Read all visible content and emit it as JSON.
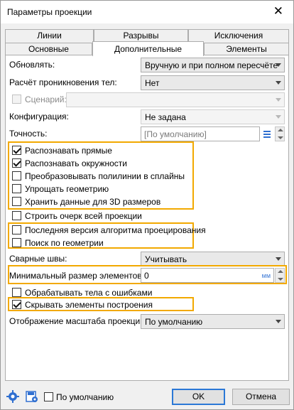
{
  "window": {
    "title": "Параметры проекции",
    "close_glyph": "✕"
  },
  "tabs_back": [
    {
      "label": "Линии"
    },
    {
      "label": "Разрывы"
    },
    {
      "label": "Исключения"
    }
  ],
  "tabs_front": [
    {
      "label": "Основные"
    },
    {
      "label": "Дополнительные",
      "active": true
    },
    {
      "label": "Элементы"
    }
  ],
  "fields": {
    "update": {
      "label": "Обновлять:",
      "value": "Вручную и при полном пересчёте"
    },
    "penetration": {
      "label": "Расчёт проникновения тел:",
      "value": "Нет"
    },
    "scenario": {
      "label": "Сценарий:",
      "value": "",
      "checked": false,
      "disabled": true
    },
    "configuration": {
      "label": "Конфигурация:",
      "value": "Не задана"
    },
    "accuracy": {
      "label": "Точность:",
      "placeholder": "[По умолчанию]"
    }
  },
  "checkboxes_group1": [
    {
      "label": "Распознавать прямые",
      "checked": true
    },
    {
      "label": "Распознавать окружности",
      "checked": true
    },
    {
      "label": "Преобразовывать полилинии в сплайны",
      "checked": false
    },
    {
      "label": "Упрощать геометрию",
      "checked": false
    },
    {
      "label": "Хранить данные для 3D размеров",
      "checked": false
    }
  ],
  "checkbox_sketch": {
    "label": "Строить очерк всей проекции",
    "checked": false
  },
  "checkboxes_group2": [
    {
      "label": "Последняя версия алгоритма проецирования",
      "checked": false
    },
    {
      "label": "Поиск по геометрии",
      "checked": false
    }
  ],
  "welds": {
    "label": "Сварные швы:",
    "value": "Учитывать"
  },
  "min_size": {
    "label": "Минимальный размер элементов:",
    "value": "0",
    "unit": "мм"
  },
  "checkbox_errors": {
    "label": "Обрабатывать тела с ошибками",
    "checked": false
  },
  "checkbox_hide": {
    "label": "Скрывать элементы построения",
    "checked": true
  },
  "scale_display": {
    "label": "Отображение масштаба проекции:",
    "value": "По умолчанию"
  },
  "footer": {
    "default_label": "По умолчанию",
    "default_checked": false,
    "ok_label": "OK",
    "cancel_label": "Отмена"
  },
  "colors": {
    "highlight": "#f2a900",
    "accent": "#2b78d6"
  }
}
